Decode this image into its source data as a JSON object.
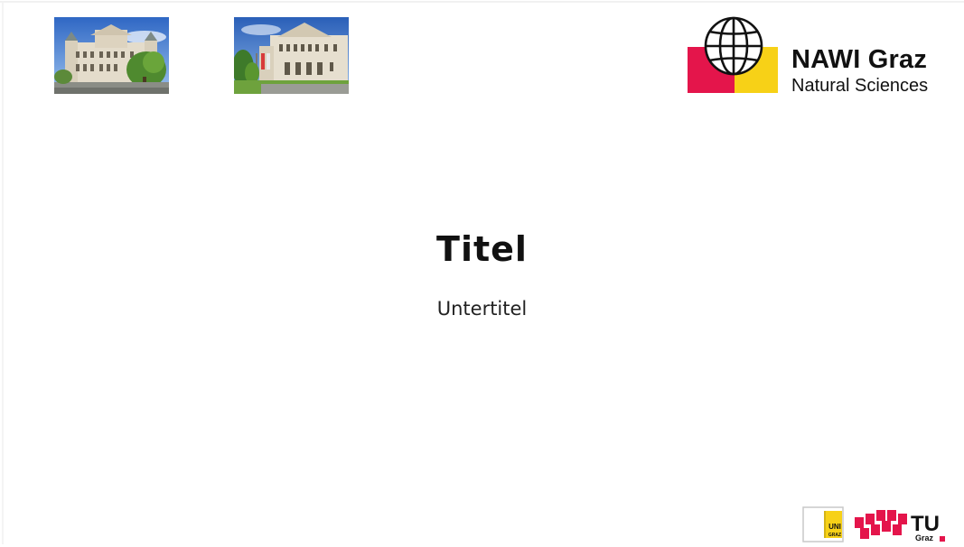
{
  "header": {
    "photos": [
      {
        "name": "university-main-building-photo"
      },
      {
        "name": "university-building-facade-photo"
      }
    ],
    "nawi_logo": {
      "title": "NAWI Graz",
      "subtitle": "Natural Sciences",
      "colors": {
        "magenta": "#e4154b",
        "yellow": "#f7d117",
        "globe": "#111111"
      }
    }
  },
  "main": {
    "title": "Titel",
    "subtitle": "Untertitel"
  },
  "footer": {
    "uni_graz_logo": {
      "line1": "UNI",
      "line2": "GRAZ",
      "color": "#f7d117"
    },
    "tu_graz_logo": {
      "text": "TU",
      "subtext": "Graz",
      "color": "#e4154b"
    }
  }
}
